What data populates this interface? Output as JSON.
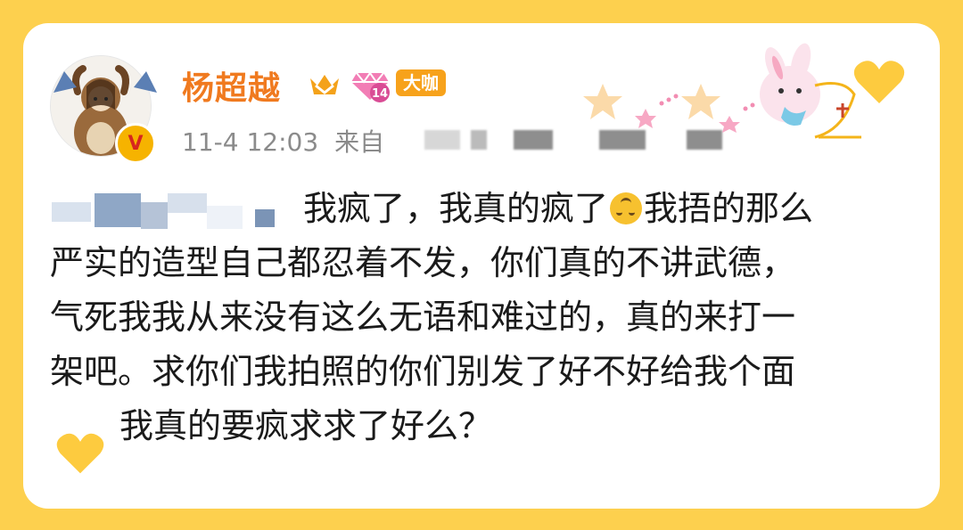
{
  "post": {
    "username": "杨超越",
    "badge_label": "大咖",
    "diamond_level": "14",
    "timestamp": "11-4 12:03",
    "source_prefix": "来自",
    "lines": [
      "我疯了，我真的疯了",
      "我捂的那么",
      "严实的造型自己都忍着不发，你们真的不讲武德，",
      "气死我我从来没有这么无语和难过的，真的来打一",
      "架吧。求你们我拍照的你们别发了好不好给我个面",
      "我真的要疯求求了好么？"
    ],
    "emoji": "upside-down-face",
    "verified_mark": "V"
  },
  "colors": {
    "background": "#FDD04E",
    "username": "#F07A1F",
    "meta": "#8b8b8b",
    "text": "#1a1a1a",
    "heart": "#FDCB3F"
  }
}
